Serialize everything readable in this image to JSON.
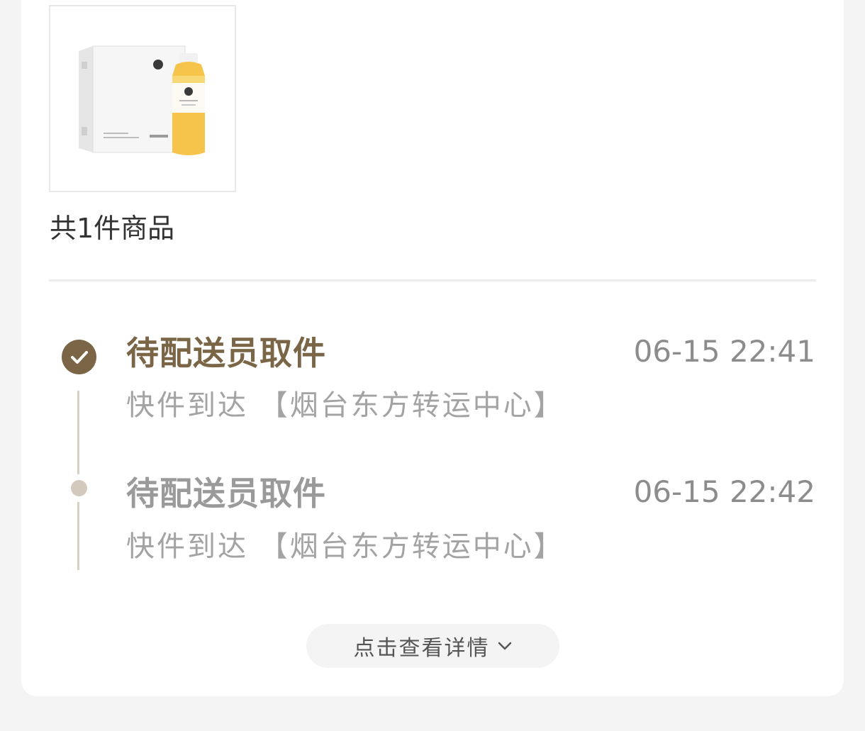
{
  "product": {
    "image_alt": "箱装果汁与瓶装果汁",
    "count_text": "共1件商品"
  },
  "timeline": [
    {
      "title": "待配送员取件",
      "time": "06-15 22:41",
      "desc": "快件到达 【烟台东方转运中心】",
      "active": true
    },
    {
      "title": "待配送员取件",
      "time": "06-15 22:42",
      "desc": "快件到达 【烟台东方转运中心】",
      "active": false
    }
  ],
  "more_button": {
    "label": "点击查看详情",
    "icon": "chevron-down-icon"
  },
  "colors": {
    "accent": "#7a6646",
    "inactive_title": "#9a9a9a",
    "line": "#d7cfc3"
  }
}
